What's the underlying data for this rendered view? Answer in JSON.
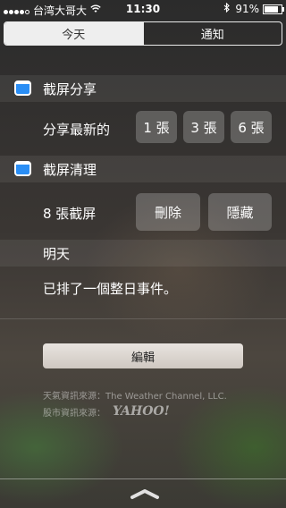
{
  "status_bar": {
    "carrier": "台湾大哥大",
    "time": "11:30",
    "battery_percent": "91%",
    "battery_level": 0.91,
    "signal_bars_filled": 4,
    "signal_bars_total": 5
  },
  "tabs": [
    {
      "label": "今天",
      "active": true
    },
    {
      "label": "通知",
      "active": false
    }
  ],
  "widgets": [
    {
      "title": "截屏分享",
      "row_label": "分享最新的",
      "buttons": [
        "1 張",
        "3 張",
        "6 張"
      ]
    },
    {
      "title": "截屏清理",
      "row_label": "8 張截屏",
      "buttons": [
        "刪除",
        "隱藏"
      ]
    }
  ],
  "tomorrow": {
    "title": "明天",
    "summary": "已排了一個整日事件。"
  },
  "edit_button": "編輯",
  "attribution": {
    "weather": "天氣資訊來源：The Weather Channel, LLC.",
    "stocks": "股市資訊來源：",
    "stocks_brand": "YAHOO!"
  },
  "icons": {
    "wifi": "wifi-icon",
    "bluetooth": "bluetooth-icon",
    "widget_app": "screenshot-app-icon",
    "grabber": "chevron-up-icon"
  },
  "colors": {
    "widget_icon": "#2a8ef5",
    "edit_button_bg": "#ded8d2"
  }
}
